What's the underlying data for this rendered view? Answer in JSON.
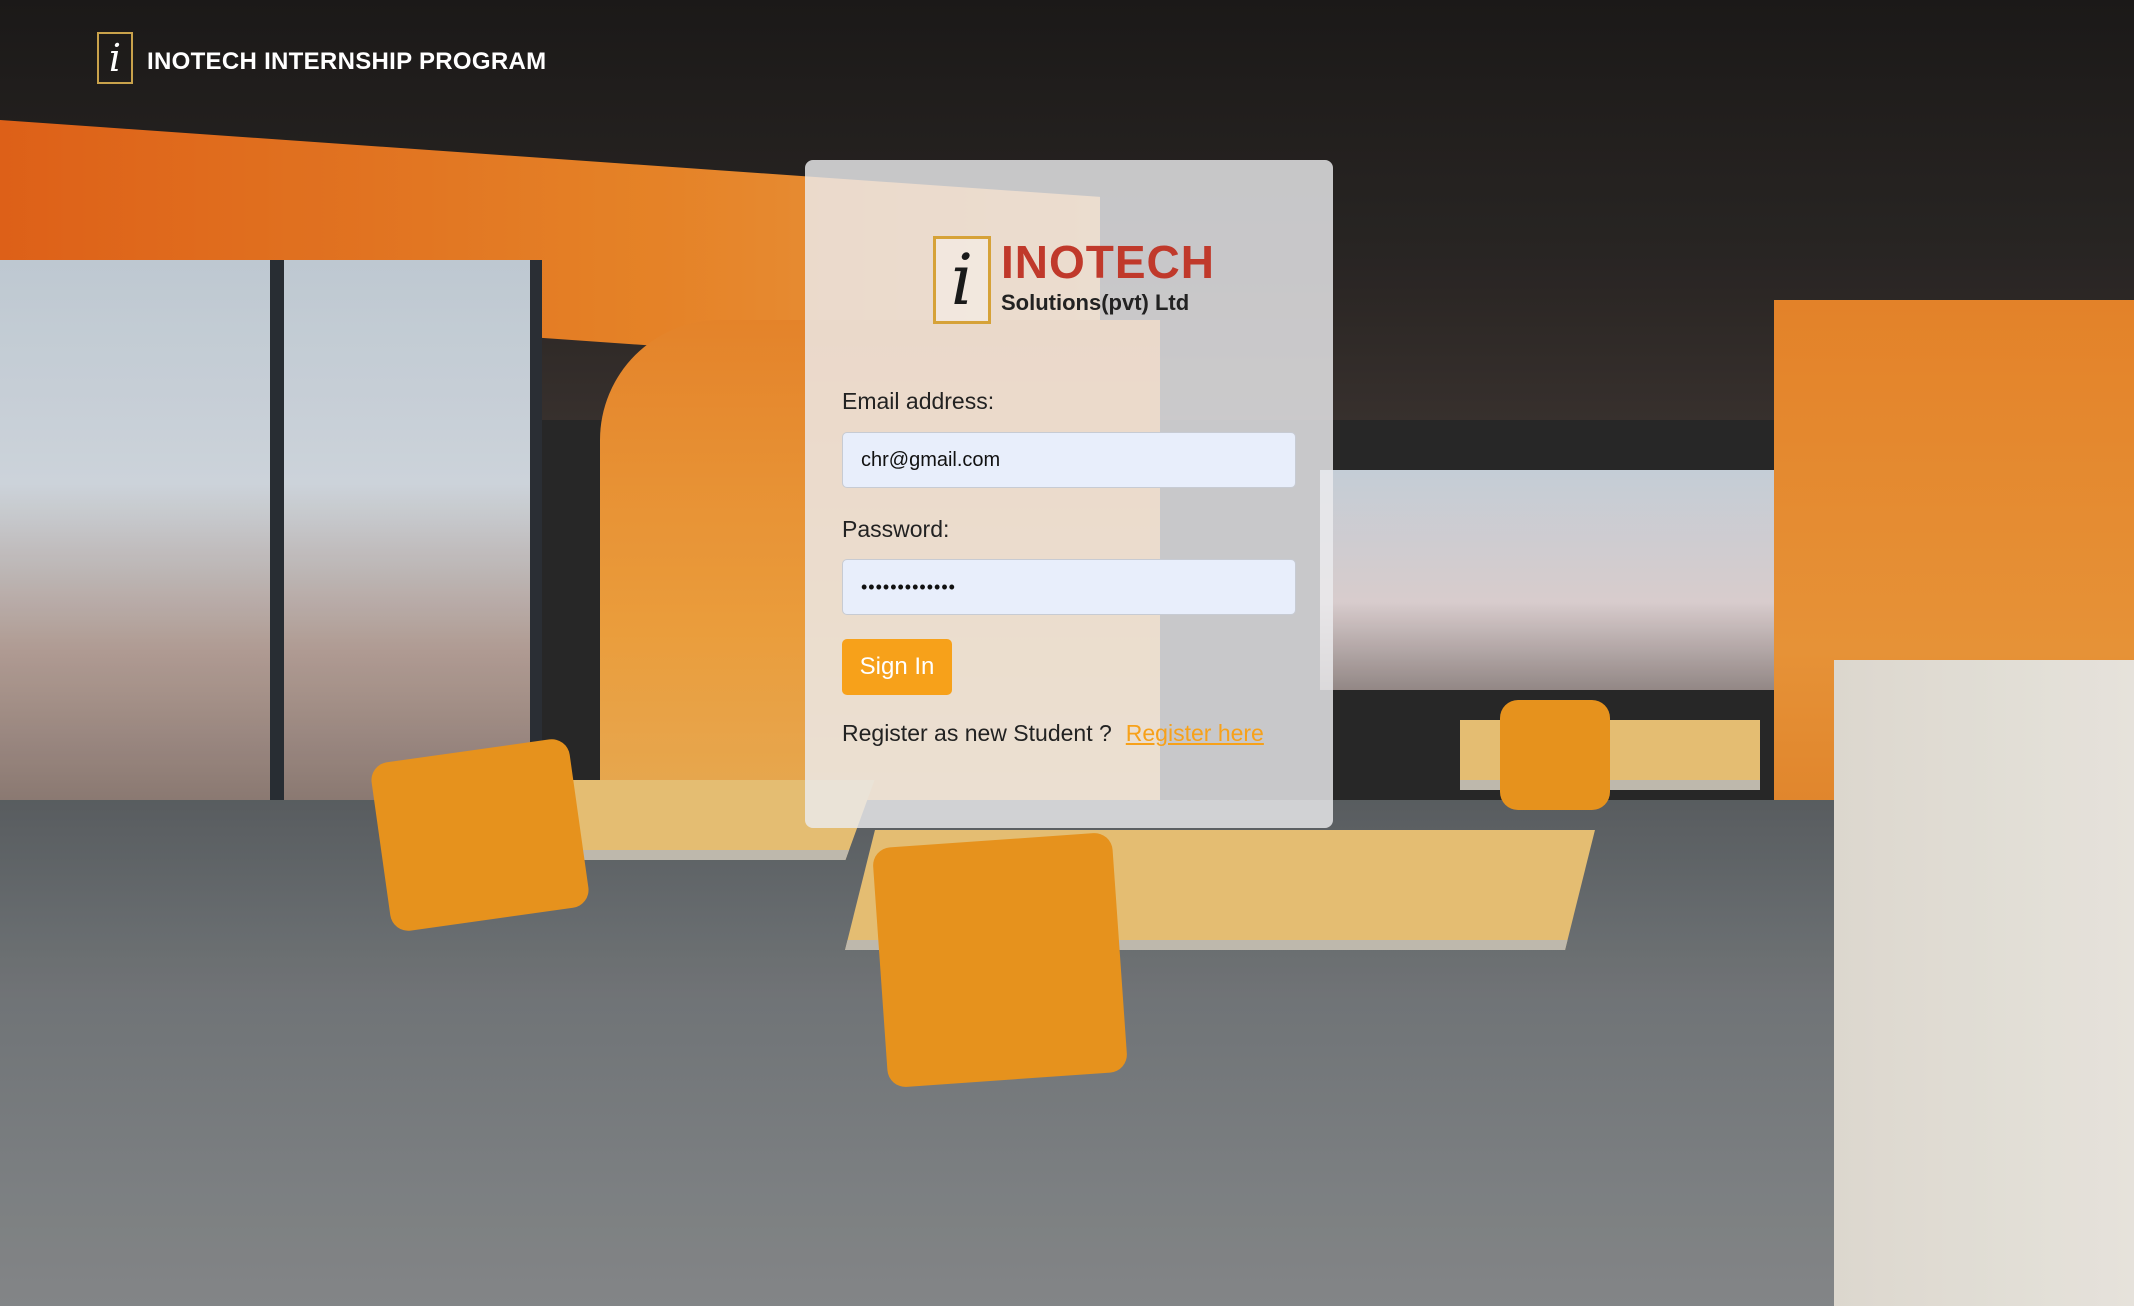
{
  "header": {
    "logo_letter": "i",
    "title": "INOTECH INTERNSHIP PROGRAM"
  },
  "login": {
    "brand_letter": "i",
    "brand_name": "INOTECH",
    "brand_subtitle": "Solutions(pvt) Ltd",
    "email_label": "Email address:",
    "email_value": "chr@gmail.com",
    "password_label": "Password:",
    "password_value": "•••••••••••••",
    "signin_label": "Sign In",
    "register_prompt": "Register as new Student ?",
    "register_link": "Register here"
  },
  "colors": {
    "accent": "#f7a11a",
    "brand_red": "#c0392b",
    "logo_gold": "#d6a238"
  }
}
